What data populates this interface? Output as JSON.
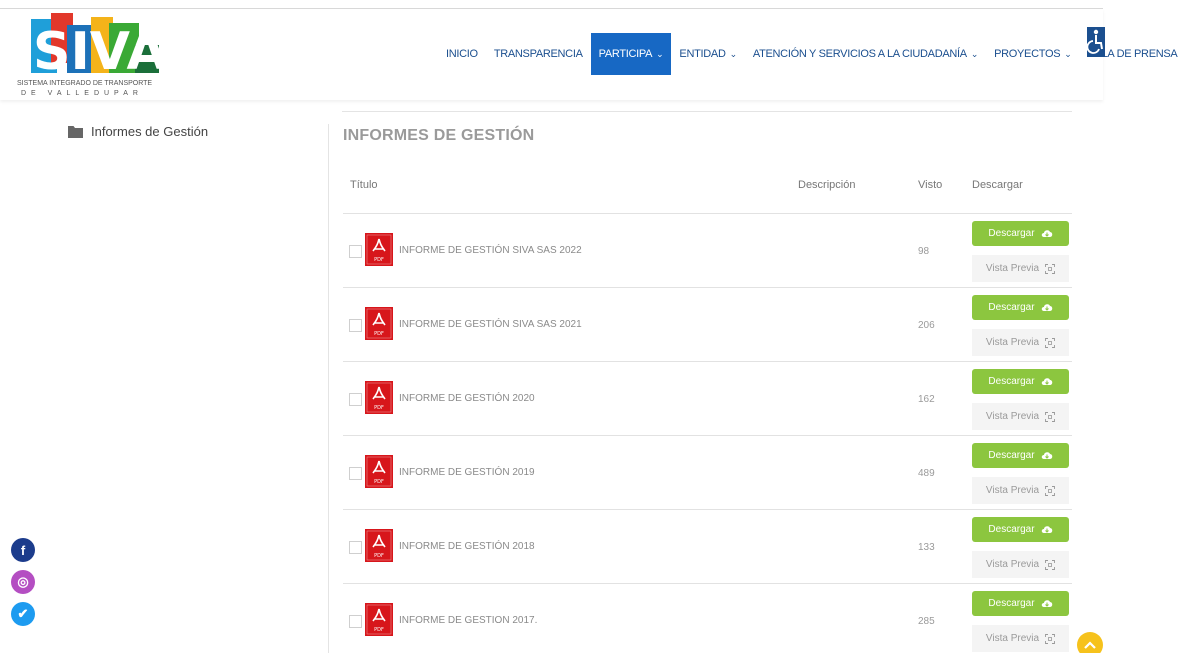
{
  "logo": {
    "text": "SIVA",
    "subtitle_line1": "SISTEMA INTEGRADO DE TRANSPORTE",
    "subtitle_line2": "DE VALLEDUPAR"
  },
  "nav": {
    "items": [
      {
        "label": "INICIO",
        "dropdown": false,
        "active": false
      },
      {
        "label": "TRANSPARENCIA",
        "dropdown": false,
        "active": false
      },
      {
        "label": "PARTICIPA",
        "dropdown": true,
        "active": true
      },
      {
        "label": "ENTIDAD",
        "dropdown": true,
        "active": false
      },
      {
        "label": "ATENCIÓN Y SERVICIOS A LA CIUDADANÍA",
        "dropdown": true,
        "active": false
      },
      {
        "label": "PROYECTOS",
        "dropdown": true,
        "active": false
      },
      {
        "label": "SALA DE PRENSA",
        "dropdown": true,
        "active": false
      }
    ],
    "active_color": "#1768c4",
    "text_color": "#1b4f8f",
    "accessibility_icon": "wheelchair-icon"
  },
  "sidebar": {
    "icon": "folder-icon",
    "label": "Informes de Gestión"
  },
  "main": {
    "title": "INFORMES DE GESTIÓN",
    "columns": {
      "title": "Título",
      "description": "Descripción",
      "views": "Visto",
      "download": "Descargar"
    },
    "download_label": "Descargar",
    "preview_label": "Vista Previa",
    "download_color": "#8cc63f",
    "files": [
      {
        "name": "INFORME DE GESTIÓN SIVA SAS 2022",
        "views": "98"
      },
      {
        "name": "INFORME DE GESTIÓN SIVA SAS 2021",
        "views": "206"
      },
      {
        "name": "INFORME DE GESTIÓN 2020",
        "views": "162"
      },
      {
        "name": "INFORME DE GESTIÓN 2019",
        "views": "489"
      },
      {
        "name": "INFORME DE GESTIÓN 2018",
        "views": "133"
      },
      {
        "name": "INFORME DE GESTION 2017.",
        "views": "285"
      }
    ]
  },
  "social": [
    {
      "name": "facebook-icon",
      "glyph": "f",
      "color": "#1c3c8c"
    },
    {
      "name": "instagram-icon",
      "glyph": "◎",
      "color": "#b44ec2"
    },
    {
      "name": "twitter-icon",
      "glyph": "✔",
      "color": "#1d9bf0"
    }
  ],
  "scroll_top_color": "#f6c21c"
}
